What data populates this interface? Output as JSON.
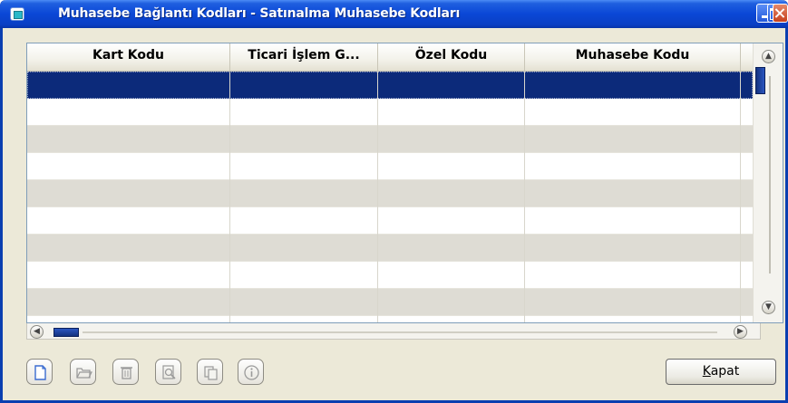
{
  "window": {
    "title": "Muhasebe Bağlantı Kodları - Satınalma Muhasebe Kodları"
  },
  "grid": {
    "columns": [
      {
        "label": "Kart Kodu"
      },
      {
        "label": "Ticari İşlem G..."
      },
      {
        "label": "Özel Kodu"
      },
      {
        "label": "Muhasebe Kodu"
      }
    ],
    "rows": [
      {
        "cells": [
          "",
          "",
          "",
          ""
        ],
        "state": "selected"
      },
      {
        "cells": [
          "",
          "",
          "",
          ""
        ],
        "state": "white"
      },
      {
        "cells": [
          "",
          "",
          "",
          ""
        ],
        "state": "gray"
      },
      {
        "cells": [
          "",
          "",
          "",
          ""
        ],
        "state": "white"
      },
      {
        "cells": [
          "",
          "",
          "",
          ""
        ],
        "state": "gray"
      },
      {
        "cells": [
          "",
          "",
          "",
          ""
        ],
        "state": "white"
      },
      {
        "cells": [
          "",
          "",
          "",
          ""
        ],
        "state": "gray"
      },
      {
        "cells": [
          "",
          "",
          "",
          ""
        ],
        "state": "white"
      },
      {
        "cells": [
          "",
          "",
          "",
          ""
        ],
        "state": "gray"
      }
    ]
  },
  "toolbar": {
    "buttons": [
      {
        "icon": "new-document-icon",
        "enabled": true
      },
      {
        "icon": "open-folder-icon",
        "enabled": false
      },
      {
        "icon": "delete-trash-icon",
        "enabled": false
      },
      {
        "icon": "search-preview-icon",
        "enabled": false
      },
      {
        "icon": "copy-icon",
        "enabled": false
      },
      {
        "icon": "info-icon",
        "enabled": false
      }
    ],
    "close_label_prefix": "K",
    "close_label_rest": "apat"
  },
  "colors": {
    "titlebar": "#0a47d6",
    "selected_row": "#0c2a7a",
    "alt_row": "#dedcd4",
    "window_bg": "#ece9d8"
  }
}
